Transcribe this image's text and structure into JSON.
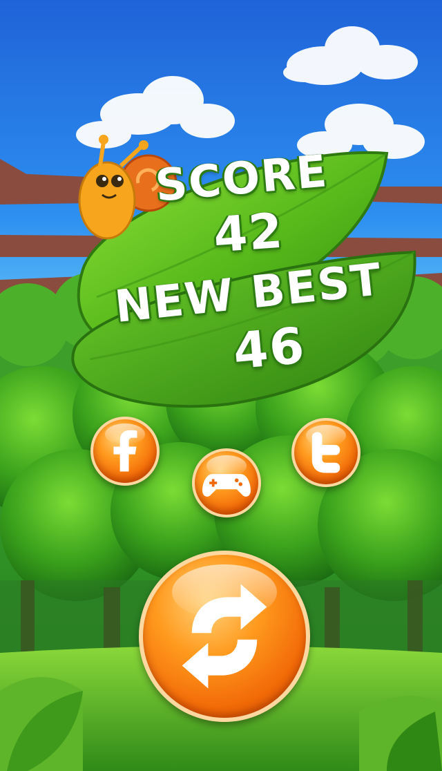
{
  "score_panel": {
    "score_label": "SCORE",
    "score_value": "42",
    "best_label": "NEW BEST",
    "best_value": "46"
  },
  "buttons": {
    "facebook_icon": "facebook-icon",
    "gamepad_icon": "gamepad-icon",
    "twitter_icon": "twitter-icon",
    "replay_icon": "replay-icon"
  },
  "colors": {
    "sky": "#2d8ff0",
    "leaf": "#5fc21c",
    "button_orange": "#f26a07",
    "text_outline": "#2e7d12"
  }
}
